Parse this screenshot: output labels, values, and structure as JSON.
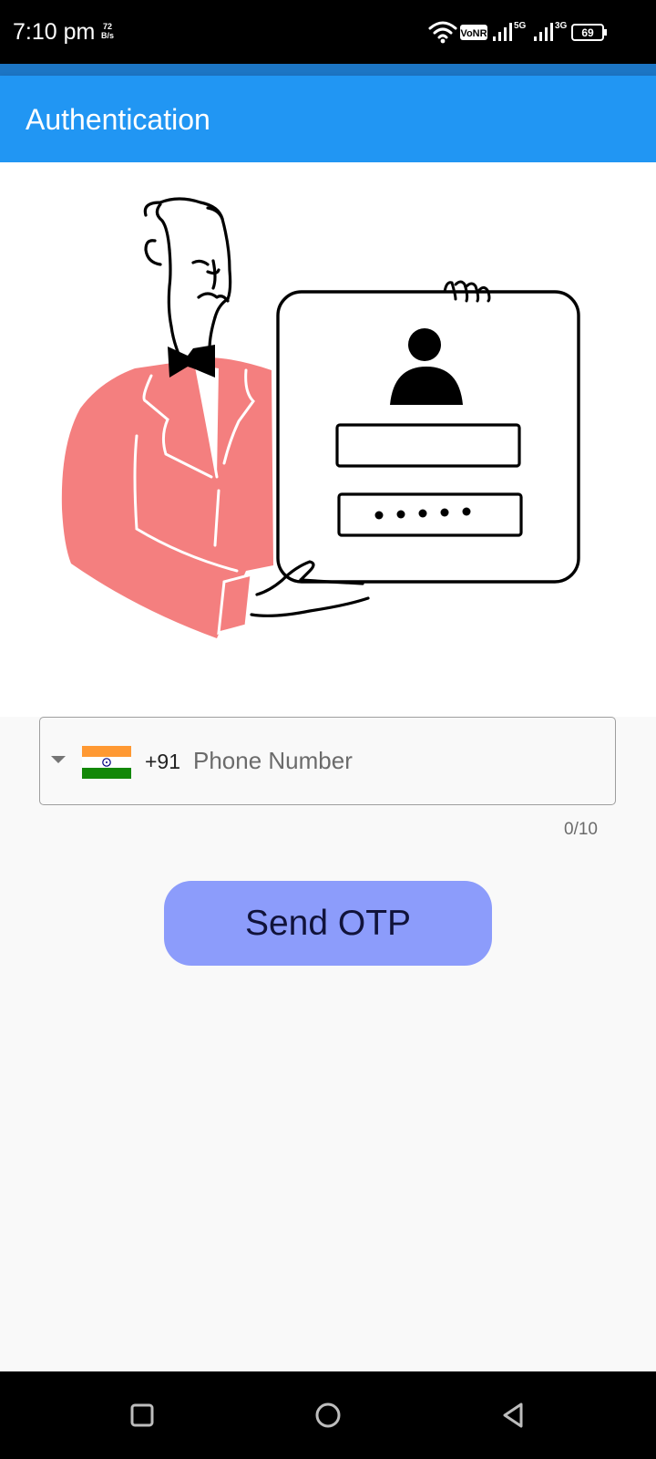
{
  "status_bar": {
    "time": "7:10 pm",
    "net_speed_value": "72",
    "net_speed_unit": "B/s",
    "volte_label": "VoNR",
    "sim1_type": "5G",
    "sim2_type": "3G",
    "battery_level": "69"
  },
  "app_bar": {
    "title": "Authentication"
  },
  "phone_field": {
    "country_flag": "india-flag",
    "dial_code": "+91",
    "placeholder": "Phone Number",
    "value": "",
    "counter": "0/10"
  },
  "actions": {
    "send_otp_label": "Send OTP"
  },
  "colors": {
    "app_bar": "#2196f3",
    "status_strip": "#1c75c4",
    "button_bg": "#8c9cfb",
    "jacket": "#f47f7f"
  },
  "nav_bar": {
    "recents_icon": "square-icon",
    "home_icon": "circle-icon",
    "back_icon": "triangle-back-icon"
  }
}
